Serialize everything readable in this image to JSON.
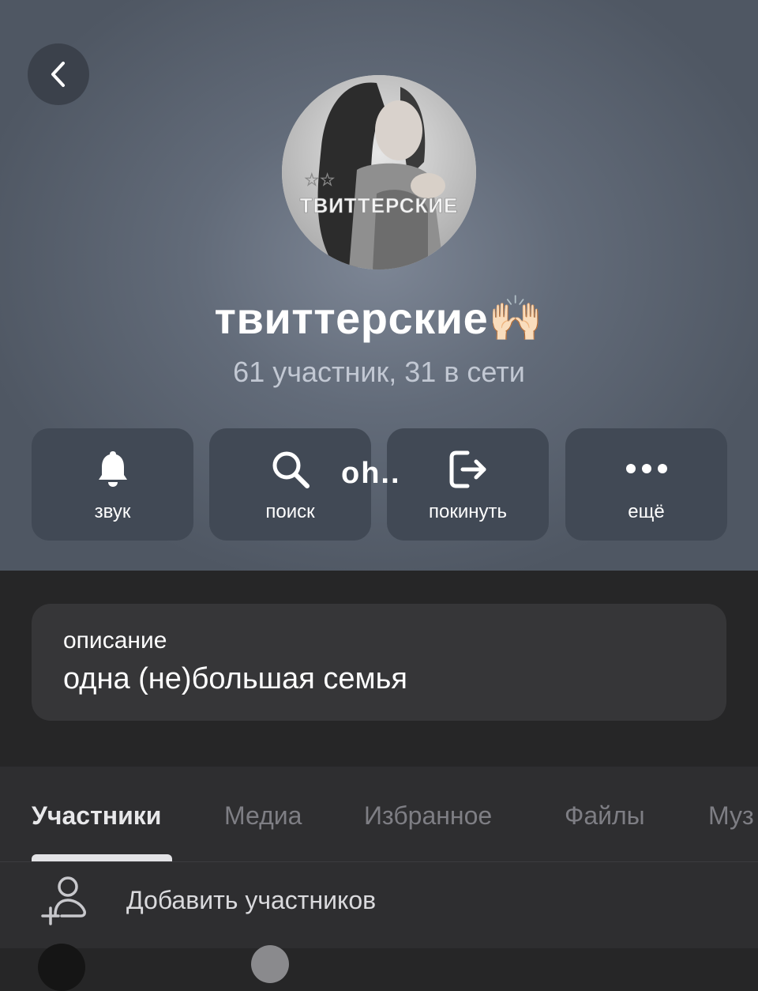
{
  "header": {
    "group_name": "твиттерские🙌🏻",
    "member_status": "61 участник, 31 в сети"
  },
  "avatar": {
    "image_text": "ТВИТТЕРСКИЕ"
  },
  "actions": [
    {
      "label": "звук",
      "icon": "bell-icon"
    },
    {
      "label": "поиск",
      "icon": "search-icon"
    },
    {
      "label": "покинуть",
      "icon": "leave-icon"
    },
    {
      "label": "ещё",
      "icon": "more-icon"
    }
  ],
  "overlay_text": "oh..",
  "description": {
    "label": "описание",
    "text": "одна (не)большая семья"
  },
  "tabs": [
    {
      "label": "Участники",
      "active": true
    },
    {
      "label": "Медиа",
      "active": false
    },
    {
      "label": "Избранное",
      "active": false
    },
    {
      "label": "Файлы",
      "active": false
    },
    {
      "label": "Муз",
      "active": false
    }
  ],
  "add_members": {
    "label": "Добавить участников",
    "icon": "add-user-icon"
  },
  "colors": {
    "header_gradient": "#626b79",
    "button_bg": "#414955",
    "card_bg": "#363638",
    "page_bg": "#262627"
  }
}
